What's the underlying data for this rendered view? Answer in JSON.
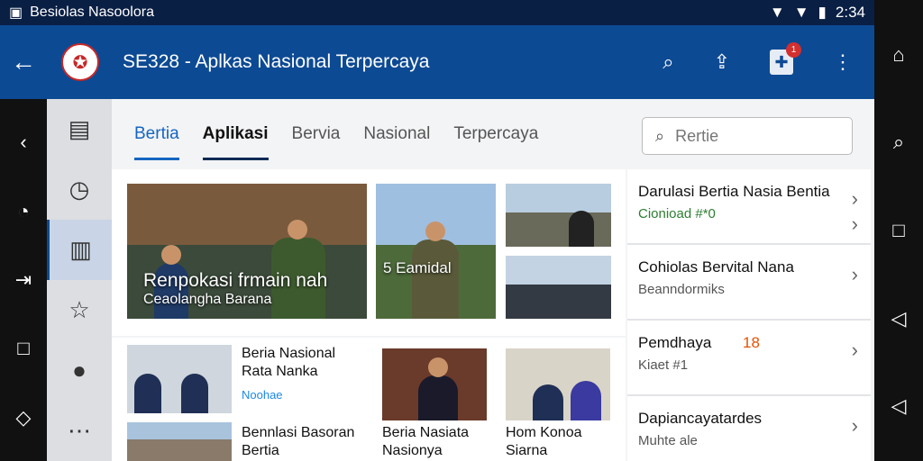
{
  "status_bar": {
    "title": "Besiolas Nasoolora",
    "time": "2:34"
  },
  "app_bar": {
    "title": "SE328 - Aplkas Nasional Terpercaya",
    "notif_count": "1"
  },
  "tabs": [
    "Bertia",
    "Aplikasi",
    "Bervia",
    "Nasional",
    "Terpercaya"
  ],
  "search": {
    "placeholder": "Rertie"
  },
  "hero": {
    "line1": "Renpokasi frmain nah",
    "line2": "Ceaolangha Barana",
    "overlay": "5 Eamidal"
  },
  "right_list": [
    {
      "title": "Darulasi Bertia Nasia Bentia",
      "sub": "Cionioad #*0"
    },
    {
      "title": "Cohiolas Bervital Nana",
      "sub": "Beanndormiks"
    },
    {
      "title": "Pemdhaya",
      "badge": "18",
      "sub": "Kiaet #1"
    },
    {
      "title": "Dapiancayatardes",
      "sub": "Muhte ale"
    }
  ],
  "bottom_cards": [
    {
      "title": "Beria Nasional",
      "title2": "Rata Nanka",
      "sub": "Noohae"
    },
    {
      "title": "Bennlasi Basoran",
      "title2": "Bertia"
    },
    {
      "title": "Beria Nasiata",
      "title2": "Nasionya"
    },
    {
      "title": "Hom Konoa",
      "title2": "Siarna"
    }
  ],
  "colors": {
    "appbar": "#0d4a94",
    "accent": "#1565c0",
    "status": "#0a1f44"
  },
  "icons": [
    "back-arrow-icon",
    "search-icon",
    "share-icon",
    "notification-icon",
    "more-vert-icon"
  ]
}
